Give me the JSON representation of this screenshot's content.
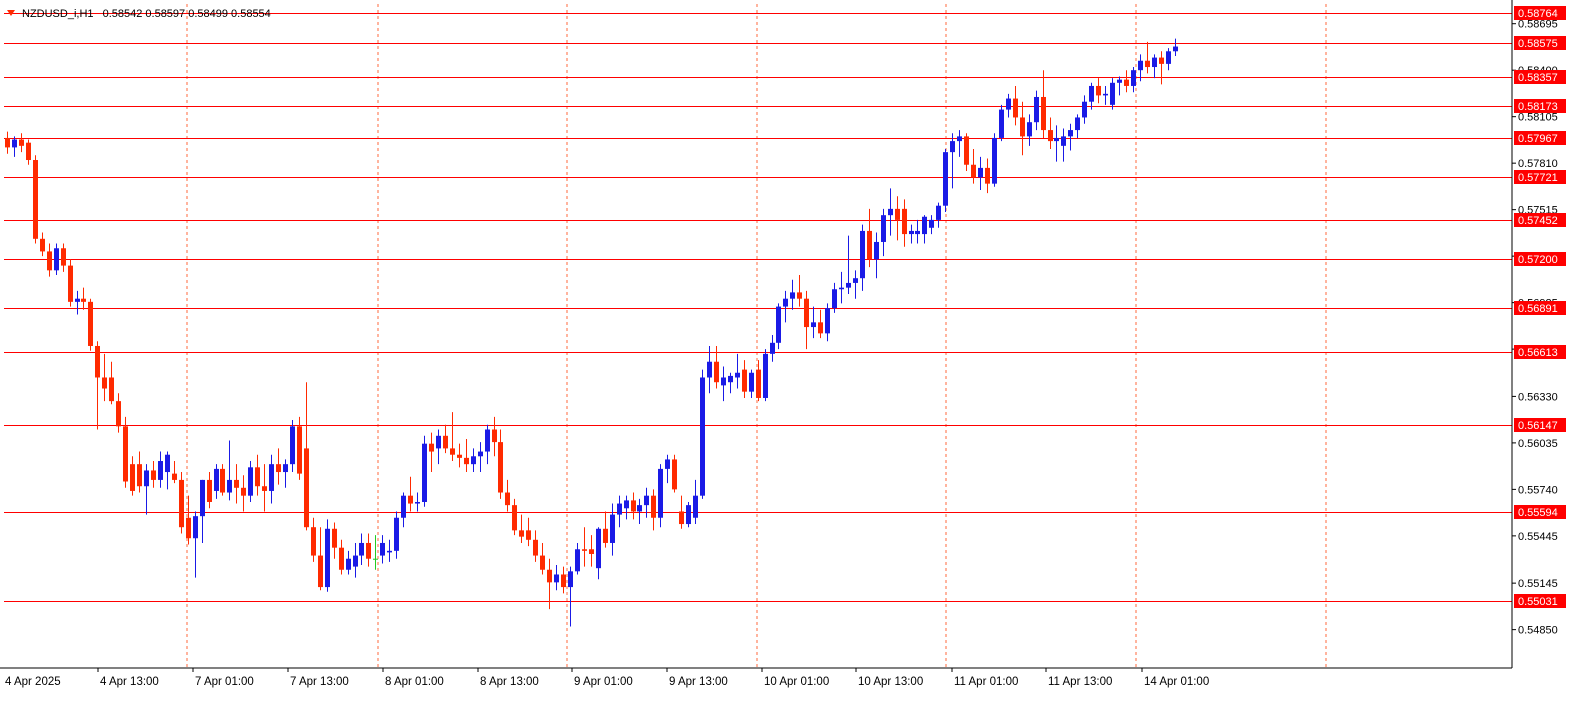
{
  "header": {
    "symbol": "NZDUSD_i,H1",
    "ohlc": "0.58542 0.58597 0.58499 0.58554"
  },
  "colors": {
    "background": "#ffffff",
    "bull_candle": "#1a1ae6",
    "bear_candle": "#ff2a00",
    "doji_candle": "#22cc22",
    "level_line": "#ff0000",
    "grid_line": "#ff6a3d",
    "level_label_bg": "#ff0000",
    "level_label_text": "#ffffff",
    "axis_text": "#000000"
  },
  "chart_data": {
    "type": "candlestick",
    "title": "",
    "xlabel": "",
    "ylabel": "",
    "ylim": [
      0.5467,
      0.5882
    ],
    "grid": true,
    "price_ticks": [
      "0.58695",
      "0.58400",
      "0.58105",
      "0.57810",
      "0.57515",
      "0.57220",
      "0.56925",
      "0.56630",
      "0.56330",
      "0.56035",
      "0.55740",
      "0.55445",
      "0.55145",
      "0.54850"
    ],
    "x_labels": [
      "4 Apr 2025",
      "4 Apr 13:00",
      "7 Apr 01:00",
      "7 Apr 13:00",
      "8 Apr 01:00",
      "8 Apr 13:00",
      "9 Apr 01:00",
      "9 Apr 13:00",
      "10 Apr 01:00",
      "10 Apr 13:00",
      "11 Apr 01:00",
      "11 Apr 13:00",
      "14 Apr 01:00"
    ],
    "level_lines": [
      "0.58764",
      "0.58575",
      "0.58357",
      "0.58173",
      "0.57967",
      "0.57721",
      "0.57452",
      "0.57200",
      "0.56891",
      "0.56613",
      "0.56147",
      "0.55594",
      "0.55031"
    ],
    "candles": [
      {
        "o": 0.5797,
        "h": 0.5801,
        "l": 0.5787,
        "c": 0.5791
      },
      {
        "o": 0.5791,
        "h": 0.5798,
        "l": 0.5785,
        "c": 0.5796
      },
      {
        "o": 0.5796,
        "h": 0.58,
        "l": 0.5788,
        "c": 0.5792
      },
      {
        "o": 0.5794,
        "h": 0.5796,
        "l": 0.578,
        "c": 0.5783
      },
      {
        "o": 0.5783,
        "h": 0.5786,
        "l": 0.573,
        "c": 0.5733
      },
      {
        "o": 0.5733,
        "h": 0.5737,
        "l": 0.5722,
        "c": 0.5725
      },
      {
        "o": 0.5725,
        "h": 0.573,
        "l": 0.5709,
        "c": 0.5713
      },
      {
        "o": 0.5713,
        "h": 0.573,
        "l": 0.571,
        "c": 0.5727
      },
      {
        "o": 0.5727,
        "h": 0.573,
        "l": 0.5712,
        "c": 0.5716
      },
      {
        "o": 0.5716,
        "h": 0.572,
        "l": 0.569,
        "c": 0.5693
      },
      {
        "o": 0.5693,
        "h": 0.57,
        "l": 0.5685,
        "c": 0.5695
      },
      {
        "o": 0.5695,
        "h": 0.5702,
        "l": 0.5688,
        "c": 0.5693
      },
      {
        "o": 0.5693,
        "h": 0.5695,
        "l": 0.5662,
        "c": 0.5665
      },
      {
        "o": 0.5665,
        "h": 0.5668,
        "l": 0.5612,
        "c": 0.5645
      },
      {
        "o": 0.5645,
        "h": 0.566,
        "l": 0.563,
        "c": 0.5638
      },
      {
        "o": 0.5645,
        "h": 0.5655,
        "l": 0.5628,
        "c": 0.563
      },
      {
        "o": 0.563,
        "h": 0.5635,
        "l": 0.561,
        "c": 0.5614
      },
      {
        "o": 0.5614,
        "h": 0.562,
        "l": 0.5575,
        "c": 0.5579
      },
      {
        "o": 0.559,
        "h": 0.5595,
        "l": 0.557,
        "c": 0.5573
      },
      {
        "o": 0.559,
        "h": 0.5598,
        "l": 0.5572,
        "c": 0.5576
      },
      {
        "o": 0.5576,
        "h": 0.559,
        "l": 0.5558,
        "c": 0.5586
      },
      {
        "o": 0.5586,
        "h": 0.5592,
        "l": 0.5575,
        "c": 0.558
      },
      {
        "o": 0.558,
        "h": 0.5598,
        "l": 0.5575,
        "c": 0.5592
      },
      {
        "o": 0.5585,
        "h": 0.5598,
        "l": 0.5574,
        "c": 0.5596
      },
      {
        "o": 0.5584,
        "h": 0.5592,
        "l": 0.5578,
        "c": 0.558
      },
      {
        "o": 0.558,
        "h": 0.5585,
        "l": 0.5546,
        "c": 0.555
      },
      {
        "o": 0.5556,
        "h": 0.557,
        "l": 0.5539,
        "c": 0.5543
      },
      {
        "o": 0.5543,
        "h": 0.556,
        "l": 0.5518,
        "c": 0.5557
      },
      {
        "o": 0.5557,
        "h": 0.558,
        "l": 0.554,
        "c": 0.558
      },
      {
        "o": 0.558,
        "h": 0.5585,
        "l": 0.5562,
        "c": 0.5566
      },
      {
        "o": 0.5573,
        "h": 0.559,
        "l": 0.5568,
        "c": 0.5587
      },
      {
        "o": 0.5587,
        "h": 0.559,
        "l": 0.557,
        "c": 0.5572
      },
      {
        "o": 0.5572,
        "h": 0.5605,
        "l": 0.5567,
        "c": 0.558
      },
      {
        "o": 0.558,
        "h": 0.559,
        "l": 0.5565,
        "c": 0.5575
      },
      {
        "o": 0.5575,
        "h": 0.5583,
        "l": 0.556,
        "c": 0.557
      },
      {
        "o": 0.557,
        "h": 0.5592,
        "l": 0.5566,
        "c": 0.5588
      },
      {
        "o": 0.5588,
        "h": 0.5596,
        "l": 0.557,
        "c": 0.5576
      },
      {
        "o": 0.5576,
        "h": 0.559,
        "l": 0.556,
        "c": 0.5573
      },
      {
        "o": 0.5573,
        "h": 0.5596,
        "l": 0.5565,
        "c": 0.559
      },
      {
        "o": 0.559,
        "h": 0.56,
        "l": 0.5577,
        "c": 0.5585
      },
      {
        "o": 0.5585,
        "h": 0.5593,
        "l": 0.5575,
        "c": 0.559
      },
      {
        "o": 0.559,
        "h": 0.5618,
        "l": 0.5585,
        "c": 0.5614
      },
      {
        "o": 0.5614,
        "h": 0.562,
        "l": 0.558,
        "c": 0.5584
      },
      {
        "o": 0.56,
        "h": 0.5642,
        "l": 0.5548,
        "c": 0.555
      },
      {
        "o": 0.555,
        "h": 0.5556,
        "l": 0.5528,
        "c": 0.5532
      },
      {
        "o": 0.5532,
        "h": 0.555,
        "l": 0.551,
        "c": 0.5512
      },
      {
        "o": 0.5512,
        "h": 0.5555,
        "l": 0.5509,
        "c": 0.5549
      },
      {
        "o": 0.5549,
        "h": 0.5553,
        "l": 0.553,
        "c": 0.5537
      },
      {
        "o": 0.5537,
        "h": 0.5542,
        "l": 0.552,
        "c": 0.5523
      },
      {
        "o": 0.5523,
        "h": 0.5535,
        "l": 0.552,
        "c": 0.553
      },
      {
        "o": 0.5525,
        "h": 0.554,
        "l": 0.5518,
        "c": 0.5532
      },
      {
        "o": 0.5532,
        "h": 0.5546,
        "l": 0.5526,
        "c": 0.554
      },
      {
        "o": 0.554,
        "h": 0.5546,
        "l": 0.5525,
        "c": 0.553
      },
      {
        "o": 0.553,
        "h": 0.5545,
        "l": 0.5523,
        "c": 0.553
      },
      {
        "o": 0.5532,
        "h": 0.5545,
        "l": 0.5527,
        "c": 0.554
      },
      {
        "o": 0.5534,
        "h": 0.5542,
        "l": 0.5528,
        "c": 0.5535
      },
      {
        "o": 0.5535,
        "h": 0.556,
        "l": 0.553,
        "c": 0.5556
      },
      {
        "o": 0.5556,
        "h": 0.5572,
        "l": 0.555,
        "c": 0.557
      },
      {
        "o": 0.557,
        "h": 0.5582,
        "l": 0.556,
        "c": 0.5565
      },
      {
        "o": 0.5565,
        "h": 0.5572,
        "l": 0.556,
        "c": 0.5566
      },
      {
        "o": 0.5566,
        "h": 0.5608,
        "l": 0.5563,
        "c": 0.5603
      },
      {
        "o": 0.5603,
        "h": 0.561,
        "l": 0.5585,
        "c": 0.5598
      },
      {
        "o": 0.56,
        "h": 0.5612,
        "l": 0.559,
        "c": 0.5608
      },
      {
        "o": 0.5608,
        "h": 0.5615,
        "l": 0.5597,
        "c": 0.56
      },
      {
        "o": 0.56,
        "h": 0.5623,
        "l": 0.5592,
        "c": 0.5596
      },
      {
        "o": 0.5596,
        "h": 0.5603,
        "l": 0.5588,
        "c": 0.5594
      },
      {
        "o": 0.5594,
        "h": 0.5606,
        "l": 0.5585,
        "c": 0.559
      },
      {
        "o": 0.559,
        "h": 0.56,
        "l": 0.5585,
        "c": 0.5595
      },
      {
        "o": 0.5595,
        "h": 0.5604,
        "l": 0.5585,
        "c": 0.5598
      },
      {
        "o": 0.5598,
        "h": 0.5615,
        "l": 0.559,
        "c": 0.5612
      },
      {
        "o": 0.5612,
        "h": 0.562,
        "l": 0.5595,
        "c": 0.5604
      },
      {
        "o": 0.5604,
        "h": 0.5612,
        "l": 0.5568,
        "c": 0.5572
      },
      {
        "o": 0.5572,
        "h": 0.558,
        "l": 0.556,
        "c": 0.5564
      },
      {
        "o": 0.5564,
        "h": 0.5568,
        "l": 0.5545,
        "c": 0.5548
      },
      {
        "o": 0.5548,
        "h": 0.5558,
        "l": 0.554,
        "c": 0.5544
      },
      {
        "o": 0.5548,
        "h": 0.5556,
        "l": 0.5538,
        "c": 0.5542
      },
      {
        "o": 0.5542,
        "h": 0.5548,
        "l": 0.5528,
        "c": 0.5532
      },
      {
        "o": 0.5532,
        "h": 0.554,
        "l": 0.552,
        "c": 0.5523
      },
      {
        "o": 0.5523,
        "h": 0.553,
        "l": 0.5498,
        "c": 0.5515
      },
      {
        "o": 0.5515,
        "h": 0.5526,
        "l": 0.551,
        "c": 0.552
      },
      {
        "o": 0.552,
        "h": 0.5525,
        "l": 0.5508,
        "c": 0.5512
      },
      {
        "o": 0.5512,
        "h": 0.5525,
        "l": 0.5487,
        "c": 0.5522
      },
      {
        "o": 0.5522,
        "h": 0.554,
        "l": 0.552,
        "c": 0.5536
      },
      {
        "o": 0.5536,
        "h": 0.555,
        "l": 0.5525,
        "c": 0.5535
      },
      {
        "o": 0.5536,
        "h": 0.5545,
        "l": 0.5525,
        "c": 0.5533
      },
      {
        "o": 0.5524,
        "h": 0.555,
        "l": 0.5517,
        "c": 0.5549
      },
      {
        "o": 0.5549,
        "h": 0.556,
        "l": 0.5537,
        "c": 0.554
      },
      {
        "o": 0.554,
        "h": 0.5565,
        "l": 0.5532,
        "c": 0.5558
      },
      {
        "o": 0.5558,
        "h": 0.557,
        "l": 0.555,
        "c": 0.5565
      },
      {
        "o": 0.5562,
        "h": 0.557,
        "l": 0.5555,
        "c": 0.5567
      },
      {
        "o": 0.5567,
        "h": 0.5572,
        "l": 0.5555,
        "c": 0.556
      },
      {
        "o": 0.556,
        "h": 0.5568,
        "l": 0.5552,
        "c": 0.5564
      },
      {
        "o": 0.5564,
        "h": 0.5575,
        "l": 0.5556,
        "c": 0.557
      },
      {
        "o": 0.557,
        "h": 0.5574,
        "l": 0.5548,
        "c": 0.5556
      },
      {
        "o": 0.5556,
        "h": 0.559,
        "l": 0.555,
        "c": 0.5587
      },
      {
        "o": 0.5587,
        "h": 0.5596,
        "l": 0.5578,
        "c": 0.5593
      },
      {
        "o": 0.5593,
        "h": 0.5596,
        "l": 0.5572,
        "c": 0.5574
      },
      {
        "o": 0.556,
        "h": 0.557,
        "l": 0.5549,
        "c": 0.5552
      },
      {
        "o": 0.5552,
        "h": 0.5566,
        "l": 0.555,
        "c": 0.5564
      },
      {
        "o": 0.5556,
        "h": 0.558,
        "l": 0.5552,
        "c": 0.557
      },
      {
        "o": 0.557,
        "h": 0.565,
        "l": 0.5568,
        "c": 0.5645
      },
      {
        "o": 0.5645,
        "h": 0.5665,
        "l": 0.5635,
        "c": 0.5655
      },
      {
        "o": 0.5655,
        "h": 0.5665,
        "l": 0.5638,
        "c": 0.5642
      },
      {
        "o": 0.564,
        "h": 0.5652,
        "l": 0.563,
        "c": 0.5645
      },
      {
        "o": 0.5642,
        "h": 0.5648,
        "l": 0.5635,
        "c": 0.5646
      },
      {
        "o": 0.5645,
        "h": 0.566,
        "l": 0.5638,
        "c": 0.5648
      },
      {
        "o": 0.565,
        "h": 0.5656,
        "l": 0.5632,
        "c": 0.5636
      },
      {
        "o": 0.5636,
        "h": 0.565,
        "l": 0.5632,
        "c": 0.5648
      },
      {
        "o": 0.565,
        "h": 0.5656,
        "l": 0.563,
        "c": 0.5632
      },
      {
        "o": 0.5632,
        "h": 0.5663,
        "l": 0.563,
        "c": 0.566
      },
      {
        "o": 0.566,
        "h": 0.5672,
        "l": 0.5655,
        "c": 0.5667
      },
      {
        "o": 0.5667,
        "h": 0.5692,
        "l": 0.5663,
        "c": 0.569
      },
      {
        "o": 0.569,
        "h": 0.57,
        "l": 0.568,
        "c": 0.5695
      },
      {
        "o": 0.5695,
        "h": 0.5707,
        "l": 0.5688,
        "c": 0.5699
      },
      {
        "o": 0.5699,
        "h": 0.571,
        "l": 0.569,
        "c": 0.5695
      },
      {
        "o": 0.5695,
        "h": 0.57,
        "l": 0.5663,
        "c": 0.5677
      },
      {
        "o": 0.5677,
        "h": 0.569,
        "l": 0.567,
        "c": 0.568
      },
      {
        "o": 0.568,
        "h": 0.5688,
        "l": 0.567,
        "c": 0.5673
      },
      {
        "o": 0.5673,
        "h": 0.5692,
        "l": 0.5668,
        "c": 0.5689
      },
      {
        "o": 0.5689,
        "h": 0.5705,
        "l": 0.5686,
        "c": 0.5701
      },
      {
        "o": 0.5701,
        "h": 0.5712,
        "l": 0.5692,
        "c": 0.5702
      },
      {
        "o": 0.5702,
        "h": 0.5735,
        "l": 0.5698,
        "c": 0.5705
      },
      {
        "o": 0.5705,
        "h": 0.5713,
        "l": 0.5695,
        "c": 0.5708
      },
      {
        "o": 0.5708,
        "h": 0.5742,
        "l": 0.57,
        "c": 0.5738
      },
      {
        "o": 0.5738,
        "h": 0.5752,
        "l": 0.5715,
        "c": 0.572
      },
      {
        "o": 0.572,
        "h": 0.5737,
        "l": 0.5708,
        "c": 0.5731
      },
      {
        "o": 0.5731,
        "h": 0.5752,
        "l": 0.5722,
        "c": 0.5748
      },
      {
        "o": 0.5748,
        "h": 0.5765,
        "l": 0.5735,
        "c": 0.5752
      },
      {
        "o": 0.5752,
        "h": 0.576,
        "l": 0.5732,
        "c": 0.5745
      },
      {
        "o": 0.5752,
        "h": 0.5758,
        "l": 0.5728,
        "c": 0.5736
      },
      {
        "o": 0.5736,
        "h": 0.5742,
        "l": 0.573,
        "c": 0.5738
      },
      {
        "o": 0.5736,
        "h": 0.5745,
        "l": 0.573,
        "c": 0.5738
      },
      {
        "o": 0.5736,
        "h": 0.5748,
        "l": 0.573,
        "c": 0.5747
      },
      {
        "o": 0.574,
        "h": 0.5748,
        "l": 0.5736,
        "c": 0.5745
      },
      {
        "o": 0.5745,
        "h": 0.5756,
        "l": 0.574,
        "c": 0.5754
      },
      {
        "o": 0.5754,
        "h": 0.579,
        "l": 0.575,
        "c": 0.5788
      },
      {
        "o": 0.5788,
        "h": 0.58,
        "l": 0.5765,
        "c": 0.5795
      },
      {
        "o": 0.5795,
        "h": 0.5802,
        "l": 0.5785,
        "c": 0.5798
      },
      {
        "o": 0.5798,
        "h": 0.58,
        "l": 0.5776,
        "c": 0.578
      },
      {
        "o": 0.578,
        "h": 0.579,
        "l": 0.5768,
        "c": 0.5772
      },
      {
        "o": 0.5772,
        "h": 0.5785,
        "l": 0.5764,
        "c": 0.5778
      },
      {
        "o": 0.5778,
        "h": 0.5784,
        "l": 0.5762,
        "c": 0.5768
      },
      {
        "o": 0.5768,
        "h": 0.58,
        "l": 0.5766,
        "c": 0.5797
      },
      {
        "o": 0.5797,
        "h": 0.5818,
        "l": 0.5795,
        "c": 0.5815
      },
      {
        "o": 0.5815,
        "h": 0.5825,
        "l": 0.581,
        "c": 0.5822
      },
      {
        "o": 0.5822,
        "h": 0.583,
        "l": 0.5805,
        "c": 0.581
      },
      {
        "o": 0.581,
        "h": 0.582,
        "l": 0.5786,
        "c": 0.5798
      },
      {
        "o": 0.5798,
        "h": 0.5812,
        "l": 0.5792,
        "c": 0.5807
      },
      {
        "o": 0.5807,
        "h": 0.5827,
        "l": 0.5802,
        "c": 0.5823
      },
      {
        "o": 0.5823,
        "h": 0.584,
        "l": 0.5797,
        "c": 0.5802
      },
      {
        "o": 0.5802,
        "h": 0.581,
        "l": 0.579,
        "c": 0.5795
      },
      {
        "o": 0.5795,
        "h": 0.5805,
        "l": 0.5782,
        "c": 0.5797
      },
      {
        "o": 0.5792,
        "h": 0.5803,
        "l": 0.5782,
        "c": 0.5798
      },
      {
        "o": 0.5798,
        "h": 0.5806,
        "l": 0.5789,
        "c": 0.5802
      },
      {
        "o": 0.5802,
        "h": 0.5812,
        "l": 0.5797,
        "c": 0.581
      },
      {
        "o": 0.581,
        "h": 0.5824,
        "l": 0.5806,
        "c": 0.582
      },
      {
        "o": 0.582,
        "h": 0.5832,
        "l": 0.5815,
        "c": 0.583
      },
      {
        "o": 0.583,
        "h": 0.5835,
        "l": 0.5819,
        "c": 0.5824
      },
      {
        "o": 0.5824,
        "h": 0.583,
        "l": 0.5818,
        "c": 0.5825
      },
      {
        "o": 0.5818,
        "h": 0.5835,
        "l": 0.5815,
        "c": 0.5832
      },
      {
        "o": 0.5832,
        "h": 0.5836,
        "l": 0.5824,
        "c": 0.5834
      },
      {
        "o": 0.5834,
        "h": 0.584,
        "l": 0.5826,
        "c": 0.583
      },
      {
        "o": 0.583,
        "h": 0.5842,
        "l": 0.5826,
        "c": 0.584
      },
      {
        "o": 0.584,
        "h": 0.585,
        "l": 0.5833,
        "c": 0.5846
      },
      {
        "o": 0.5846,
        "h": 0.5858,
        "l": 0.5838,
        "c": 0.5842
      },
      {
        "o": 0.5842,
        "h": 0.585,
        "l": 0.5835,
        "c": 0.5848
      },
      {
        "o": 0.5848,
        "h": 0.5852,
        "l": 0.5831,
        "c": 0.5844
      },
      {
        "o": 0.5844,
        "h": 0.5854,
        "l": 0.584,
        "c": 0.5852
      },
      {
        "o": 0.5852,
        "h": 0.586,
        "l": 0.5849,
        "c": 0.5855
      }
    ]
  }
}
